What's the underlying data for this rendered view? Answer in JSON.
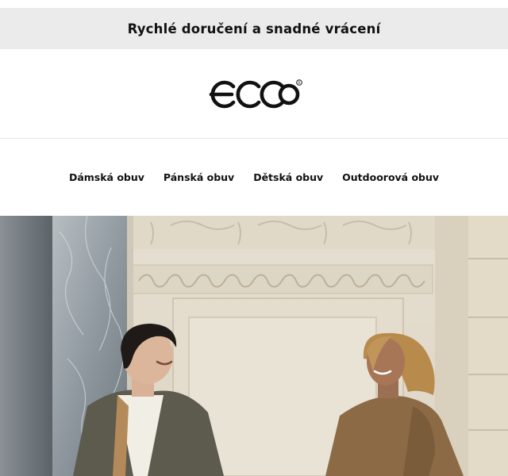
{
  "promo": {
    "text": "Rychlé doručení a snadné vrácení"
  },
  "brand": {
    "logo_text": "ecco",
    "logo_color": "#111111"
  },
  "nav": {
    "items": [
      {
        "label": "Dámská obuv"
      },
      {
        "label": "Pánská obuv"
      },
      {
        "label": "Dětská obuv"
      },
      {
        "label": "Outdoorová obuv"
      }
    ]
  },
  "hero": {
    "image": "photo-two-people-smiling-in-doorway",
    "palette": {
      "wall": "#e7e1d3",
      "marble": "#9aa4aa",
      "coat_dark": "#5d5a4e",
      "coat_tan": "#8c6a45"
    }
  }
}
